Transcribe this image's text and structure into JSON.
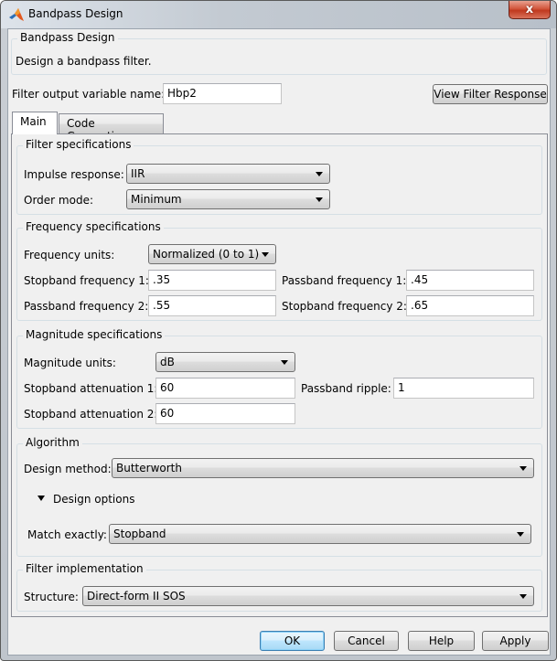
{
  "window": {
    "title": "Bandpass Design",
    "close_label": "x"
  },
  "header": {
    "group_title": "Bandpass Design",
    "description": "Design a bandpass filter."
  },
  "output_variable": {
    "label": "Filter output variable name:",
    "value": "Hbp2"
  },
  "view_response_button": "View Filter Response",
  "tabs": [
    {
      "label": "Main",
      "active": true
    },
    {
      "label": "Code Generation",
      "active": false
    }
  ],
  "filter_specifications": {
    "title": "Filter specifications",
    "impulse_response": {
      "label": "Impulse response:",
      "value": "IIR"
    },
    "order_mode": {
      "label": "Order mode:",
      "value": "Minimum"
    }
  },
  "frequency_specifications": {
    "title": "Frequency specifications",
    "frequency_units": {
      "label": "Frequency units:",
      "value": "Normalized (0 to 1)"
    },
    "stopband_frequency_1": {
      "label": "Stopband frequency 1:",
      "value": ".35"
    },
    "passband_frequency_1": {
      "label": "Passband frequency 1:",
      "value": ".45"
    },
    "passband_frequency_2": {
      "label": "Passband frequency 2:",
      "value": ".55"
    },
    "stopband_frequency_2": {
      "label": "Stopband frequency 2:",
      "value": ".65"
    }
  },
  "magnitude_specifications": {
    "title": "Magnitude specifications",
    "magnitude_units": {
      "label": "Magnitude units:",
      "value": "dB"
    },
    "stopband_attenuation_1": {
      "label": "Stopband attenuation 1:",
      "value": "60"
    },
    "passband_ripple": {
      "label": "Passband ripple:",
      "value": "1"
    },
    "stopband_attenuation_2": {
      "label": "Stopband attenuation 2:",
      "value": "60"
    }
  },
  "algorithm": {
    "title": "Algorithm",
    "design_method": {
      "label": "Design method:",
      "value": "Butterworth"
    },
    "design_options_label": "Design options",
    "match_exactly": {
      "label": "Match exactly:",
      "value": "Stopband"
    }
  },
  "filter_implementation": {
    "title": "Filter implementation",
    "structure": {
      "label": "Structure:",
      "value": "Direct-form II SOS"
    }
  },
  "footer": {
    "ok": "OK",
    "cancel": "Cancel",
    "help": "Help",
    "apply": "Apply"
  }
}
